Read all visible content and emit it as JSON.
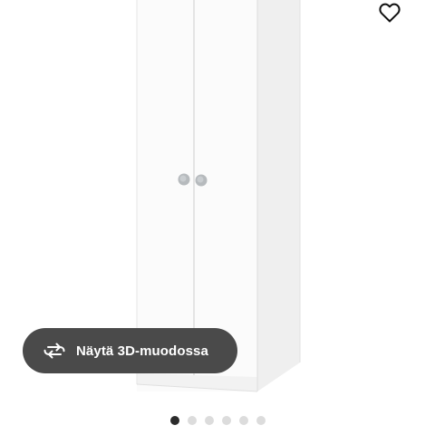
{
  "product": {
    "image_icon": "wardrobe-image"
  },
  "favorite": {
    "icon": "heart-icon"
  },
  "view_3d": {
    "label": "Näytä 3D-muodossa",
    "icon": "rotate-3d-icon"
  },
  "pager": {
    "count": 6,
    "active_index": 0
  },
  "colors": {
    "button_bg": "#4a4a4a",
    "dot_active": "#2b2b2b",
    "dot_inactive": "#dcdcdc"
  }
}
